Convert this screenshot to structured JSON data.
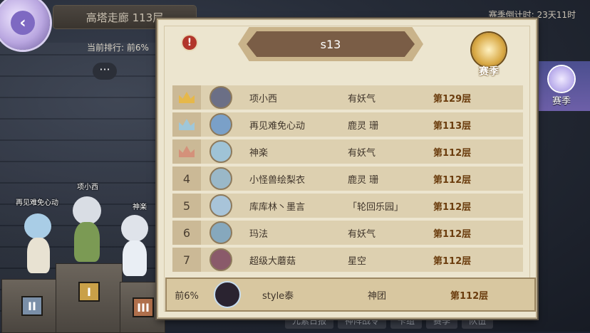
{
  "header": {
    "title": "高塔走廊 113层",
    "current_rank": "当前排行: 前6%",
    "season_timer": "赛季倒计时: 23天11时",
    "chat_icon": "chat-bubble-icon"
  },
  "season_button": {
    "label": "赛季"
  },
  "podium": {
    "characters": [
      {
        "name": "再见难免心动",
        "place": "II"
      },
      {
        "name": "项小西",
        "place": "I"
      },
      {
        "name": "神楽",
        "place": "III"
      }
    ]
  },
  "bottom_tabs": [
    "元素日报",
    "神阵战令",
    "卡组",
    "赛季",
    "队伍"
  ],
  "panel": {
    "title": "s13",
    "alert_icon": "!",
    "emblem_label": "赛季",
    "rows": [
      {
        "rank": "",
        "crown": "gold",
        "name": "项小西",
        "guild": "有妖气",
        "floor": "第129层",
        "avatar_color": "#6b6f86"
      },
      {
        "rank": "",
        "crown": "silver",
        "name": "再见难免心动",
        "guild": "鹿灵  珊",
        "floor": "第113层",
        "avatar_color": "#7aa0c8"
      },
      {
        "rank": "",
        "crown": "bronze",
        "name": "神楽",
        "guild": "有妖气",
        "floor": "第112层",
        "avatar_color": "#9fc3d6"
      },
      {
        "rank": "4",
        "crown": "",
        "name": "小怪兽绘梨衣",
        "guild": "鹿灵  珊",
        "floor": "第112层",
        "avatar_color": "#9ab8c8"
      },
      {
        "rank": "5",
        "crown": "",
        "name": "库库林丶墨言",
        "guild": "「轮回乐园」",
        "floor": "第112层",
        "avatar_color": "#a8c4d9"
      },
      {
        "rank": "6",
        "crown": "",
        "name": "玛法",
        "guild": "有妖气",
        "floor": "第112层",
        "avatar_color": "#86a8bd"
      },
      {
        "rank": "7",
        "crown": "",
        "name": "超级大蘑菇",
        "guild": "星空",
        "floor": "第112层",
        "avatar_color": "#8a5a6a"
      }
    ],
    "self_row": {
      "rank": "前6%",
      "name": "style泰",
      "guild": "神团",
      "floor": "第112层"
    }
  },
  "colors": {
    "gold": "#e6b84a",
    "silver": "#9fc7da",
    "bronze": "#d4917a",
    "floor_text": "#6b3d0e"
  }
}
